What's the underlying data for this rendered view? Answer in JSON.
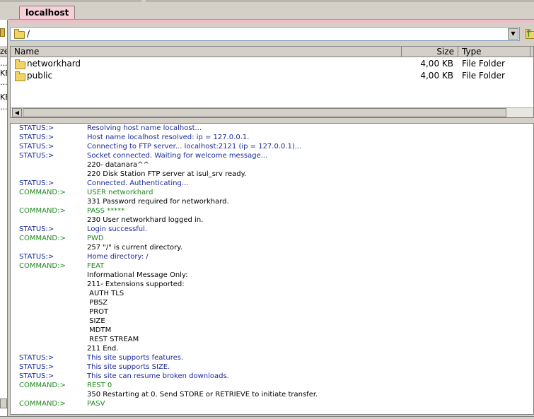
{
  "tab": {
    "label": "localhost"
  },
  "path": {
    "value": "/"
  },
  "icons": {
    "folder": "folder-icon",
    "up": "up-folder-icon",
    "dropdown": "chevron-down-icon",
    "scroll_left": "arrow-left-icon"
  },
  "colors": {
    "tab": "#f6cfd8",
    "status": "#1a2a9c",
    "command": "#1d8a1d",
    "folder": "#f3d266"
  },
  "columns": {
    "name": "Name",
    "size": "Size",
    "type": "Type"
  },
  "files": [
    {
      "name": "networkhard",
      "size": "4,00 KB",
      "type": "File Folder"
    },
    {
      "name": "public",
      "size": "4,00 KB",
      "type": "File Folder"
    }
  ],
  "left_pane": {
    "header": "ze",
    "frags": [
      "...",
      "KE",
      "...",
      "KE",
      "..."
    ]
  },
  "log": [
    {
      "kind": "status",
      "label": "STATUS:>",
      "msg": "Resolving host name localhost..."
    },
    {
      "kind": "status",
      "label": "STATUS:>",
      "msg": "Host name localhost resolved: ip = 127.0.0.1."
    },
    {
      "kind": "status",
      "label": "STATUS:>",
      "msg": "Connecting to FTP server... localhost:2121 (ip = 127.0.0.1)..."
    },
    {
      "kind": "status",
      "label": "STATUS:>",
      "msg": "Socket connected. Waiting for welcome message..."
    },
    {
      "kind": "reply",
      "label": "",
      "msg": "220- datanara^^"
    },
    {
      "kind": "reply",
      "label": "",
      "msg": "220 Disk Station FTP server at isul_srv ready."
    },
    {
      "kind": "status",
      "label": "STATUS:>",
      "msg": "Connected. Authenticating..."
    },
    {
      "kind": "command",
      "label": "COMMAND:>",
      "msg": "USER networkhard"
    },
    {
      "kind": "reply",
      "label": "",
      "msg": "331 Password required for networkhard."
    },
    {
      "kind": "command",
      "label": "COMMAND:>",
      "msg": "PASS *****"
    },
    {
      "kind": "reply",
      "label": "",
      "msg": "230 User networkhard logged in."
    },
    {
      "kind": "status",
      "label": "STATUS:>",
      "msg": "Login successful."
    },
    {
      "kind": "command",
      "label": "COMMAND:>",
      "msg": "PWD"
    },
    {
      "kind": "reply",
      "label": "",
      "msg": "257 \"/\" is current directory."
    },
    {
      "kind": "status",
      "label": "STATUS:>",
      "msg": "Home directory: /"
    },
    {
      "kind": "command",
      "label": "COMMAND:>",
      "msg": "FEAT"
    },
    {
      "kind": "reply",
      "label": "",
      "msg": "Informational Message Only:"
    },
    {
      "kind": "reply",
      "label": "",
      "msg": "211- Extensions supported:"
    },
    {
      "kind": "reply",
      "label": "",
      "msg": " AUTH TLS"
    },
    {
      "kind": "reply",
      "label": "",
      "msg": " PBSZ"
    },
    {
      "kind": "reply",
      "label": "",
      "msg": " PROT"
    },
    {
      "kind": "reply",
      "label": "",
      "msg": " SIZE"
    },
    {
      "kind": "reply",
      "label": "",
      "msg": " MDTM"
    },
    {
      "kind": "reply",
      "label": "",
      "msg": " REST STREAM"
    },
    {
      "kind": "reply",
      "label": "",
      "msg": "211 End."
    },
    {
      "kind": "status",
      "label": "STATUS:>",
      "msg": "This site supports features."
    },
    {
      "kind": "status",
      "label": "STATUS:>",
      "msg": "This site supports SIZE."
    },
    {
      "kind": "status",
      "label": "STATUS:>",
      "msg": "This site can resume broken downloads."
    },
    {
      "kind": "command",
      "label": "COMMAND:>",
      "msg": "REST 0"
    },
    {
      "kind": "reply",
      "label": "",
      "msg": "350 Restarting at 0. Send STORE or RETRIEVE to initiate transfer."
    },
    {
      "kind": "command",
      "label": "COMMAND:>",
      "msg": "PASV"
    }
  ]
}
